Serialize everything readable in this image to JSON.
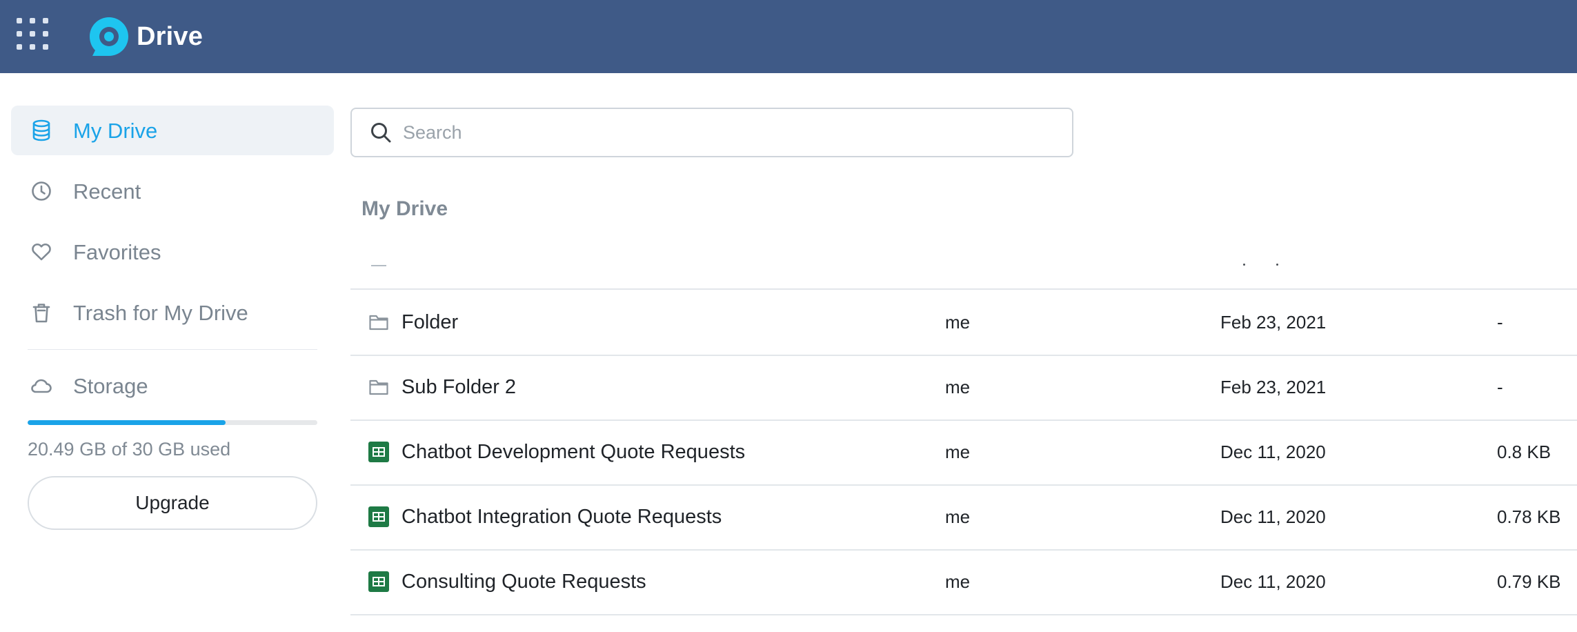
{
  "header": {
    "app_name": "Drive",
    "background_color": "#3f5a87",
    "app_grid_icon": "apps-grid-icon",
    "logo_icon": "drive-logo-icon"
  },
  "theme": {
    "accent_color": "#1aa3e8",
    "sheet_icon_color": "#1e7a45"
  },
  "sidebar": {
    "items": [
      {
        "label": "My Drive",
        "icon": "database-icon",
        "active": true
      },
      {
        "label": "Recent",
        "icon": "clock-icon",
        "active": false
      },
      {
        "label": "Favorites",
        "icon": "heart-icon",
        "active": false
      },
      {
        "label": "Trash for My Drive",
        "icon": "trash-icon",
        "active": false
      }
    ],
    "storage": {
      "label": "Storage",
      "icon": "cloud-icon",
      "used_text": "20.49 GB of 30 GB used",
      "used_fraction": 0.683
    },
    "upgrade_label": "Upgrade"
  },
  "search": {
    "placeholder": "Search",
    "value": ""
  },
  "main": {
    "title": "My Drive",
    "files": [
      {
        "type": "folder",
        "icon": "folder-icon",
        "name": "Folder",
        "owner": "me",
        "modified": "Feb 23, 2021",
        "size": "-"
      },
      {
        "type": "folder",
        "icon": "folder-icon",
        "name": "Sub Folder 2",
        "owner": "me",
        "modified": "Feb 23, 2021",
        "size": "-"
      },
      {
        "type": "spreadsheet",
        "icon": "spreadsheet-icon",
        "name": "Chatbot Development Quote Requests",
        "owner": "me",
        "modified": "Dec 11, 2020",
        "size": "0.8 KB"
      },
      {
        "type": "spreadsheet",
        "icon": "spreadsheet-icon",
        "name": "Chatbot Integration Quote Requests",
        "owner": "me",
        "modified": "Dec 11, 2020",
        "size": "0.78 KB"
      },
      {
        "type": "spreadsheet",
        "icon": "spreadsheet-icon",
        "name": "Consulting Quote Requests",
        "owner": "me",
        "modified": "Dec 11, 2020",
        "size": "0.79 KB"
      }
    ]
  }
}
